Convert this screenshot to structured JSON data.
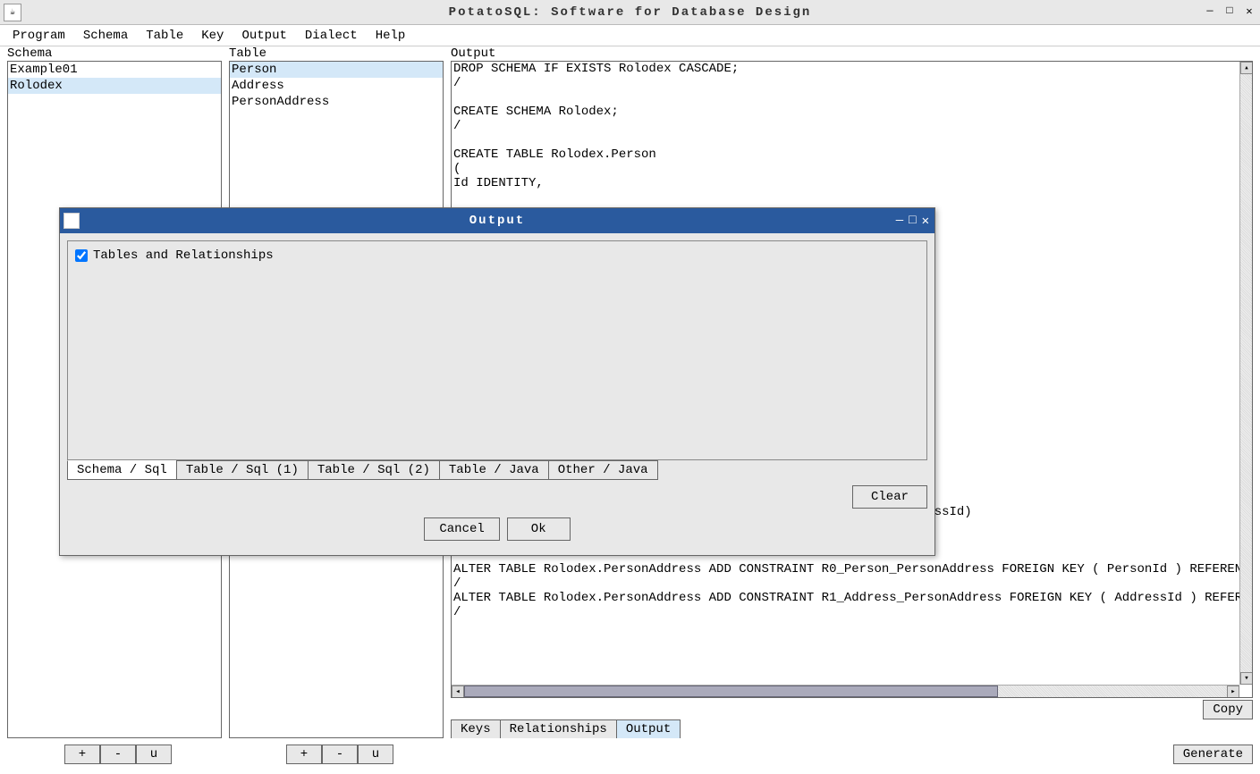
{
  "window": {
    "title": "PotatoSQL: Software for Database Design"
  },
  "menu": [
    "Program",
    "Schema",
    "Table",
    "Key",
    "Output",
    "Dialect",
    "Help"
  ],
  "schema": {
    "label": "Schema",
    "items": [
      "Example01",
      "Rolodex"
    ],
    "selected": "Rolodex"
  },
  "table": {
    "label": "Table",
    "items": [
      "Person",
      "Address",
      "PersonAddress"
    ],
    "selected": "Person"
  },
  "output_panel": {
    "label": "Output",
    "text": "DROP SCHEMA IF EXISTS Rolodex CASCADE;\n/\n\nCREATE SCHEMA Rolodex;\n/\n\nCREATE TABLE Rolodex.Person\n(\nId IDENTITY,\n\n\n\n\n\n\n\n\n\n\n\n\n\n\n\n\n\n\n\n\n\n\nCONSTRAINT PersonAddress_primaryKey PRIMARY KEY (PersonId, AddressId)\n);\n/\n\nALTER TABLE Rolodex.PersonAddress ADD CONSTRAINT R0_Person_PersonAddress FOREIGN KEY ( PersonId ) REFERENCES\n/\nALTER TABLE Rolodex.PersonAddress ADD CONSTRAINT R1_Address_PersonAddress FOREIGN KEY ( AddressId ) REFERENC\n/",
    "copy": "Copy"
  },
  "bottom_tabs": {
    "items": [
      "Keys",
      "Relationships",
      "Output"
    ],
    "active": "Output"
  },
  "footer": {
    "schema_buttons": [
      "+",
      "-",
      "u"
    ],
    "table_buttons": [
      "+",
      "-",
      "u"
    ],
    "generate": "Generate"
  },
  "dialog": {
    "title": "Output",
    "checkbox_label": "Tables and Relationships",
    "checkbox_checked": true,
    "tabs": [
      "Schema / Sql",
      "Table / Sql (1)",
      "Table / Sql (2)",
      "Table / Java",
      "Other / Java"
    ],
    "active_tab": "Schema / Sql",
    "clear": "Clear",
    "cancel": "Cancel",
    "ok": "Ok"
  }
}
